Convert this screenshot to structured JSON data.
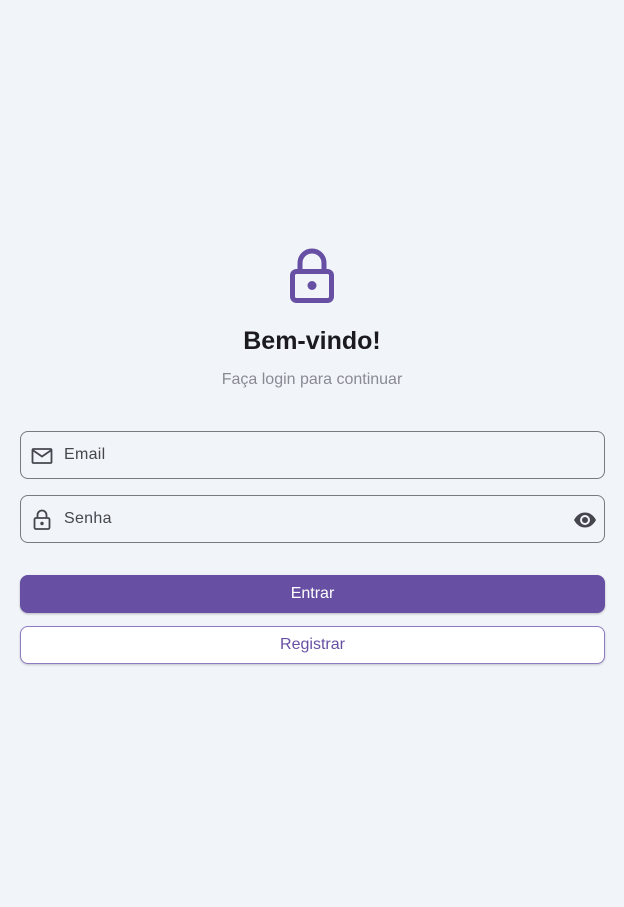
{
  "header": {
    "icon": "lock-icon",
    "title": "Bem-vindo!",
    "subtitle": "Faça login para continuar"
  },
  "form": {
    "email": {
      "icon": "mail-icon",
      "placeholder": "Email",
      "value": ""
    },
    "password": {
      "icon": "lock-icon",
      "placeholder": "Senha",
      "value": "",
      "toggle_icon": "eye-icon"
    }
  },
  "actions": {
    "login_label": "Entrar",
    "register_label": "Registrar"
  },
  "colors": {
    "accent": "#6750a4",
    "background": "#f1f4f9",
    "title": "#1b1b1f",
    "subtitle": "#8a8a94"
  }
}
